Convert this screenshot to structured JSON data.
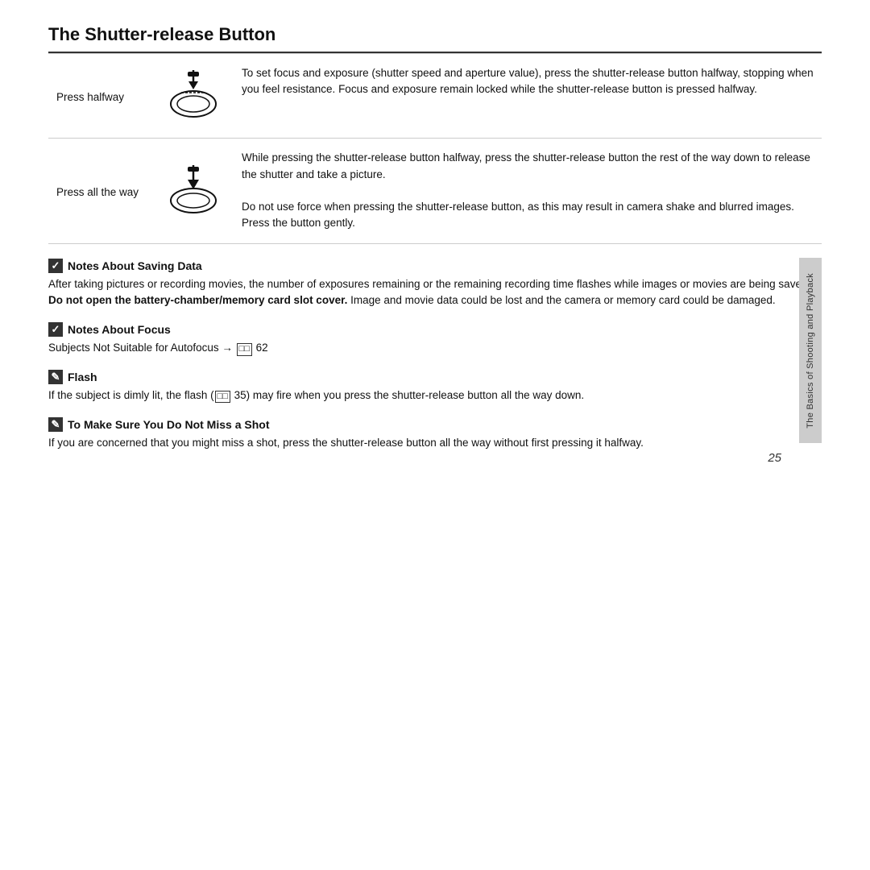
{
  "title": "The Shutter-release Button",
  "table": {
    "rows": [
      {
        "label": "Press halfway",
        "description": "To set focus and exposure (shutter speed and aperture value), press the shutter-release button halfway, stopping when you feel resistance. Focus and exposure remain locked while the shutter-release button is pressed halfway."
      },
      {
        "label": "Press all the way",
        "description_parts": [
          "While pressing the shutter-release button halfway, press the shutter-release button the rest of the way down to release the shutter and take a picture.",
          "Do not use force when pressing the shutter-release button, as this may result in camera shake and blurred images. Press the button gently."
        ]
      }
    ]
  },
  "notes": [
    {
      "type": "check",
      "heading": "Notes About Saving Data",
      "body_html": "After taking pictures or recording movies, the number of exposures remaining or the remaining recording time flashes while images or movies are being saved. <b>Do not open the battery-chamber/memory card slot cover.</b> Image and movie data could be lost and the camera or memory card could be damaged."
    },
    {
      "type": "check",
      "heading": "Notes About Focus",
      "body_html": "Subjects Not Suitable for Autofocus → <span class=\"ref-box\">□□</span> 62"
    },
    {
      "type": "pencil",
      "heading": "Flash",
      "body_html": "If the subject is dimly lit, the flash (<span class=\"ref-box\">□□</span> 35) may fire when you press the shutter-release button all the way down."
    },
    {
      "type": "pencil",
      "heading": "To Make Sure You Do Not Miss a Shot",
      "body_html": "If you are concerned that you might miss a shot, press the shutter-release button all the way without first pressing it halfway."
    }
  ],
  "side_tab": "The Basics of Shooting and Playback",
  "page_number": "25"
}
